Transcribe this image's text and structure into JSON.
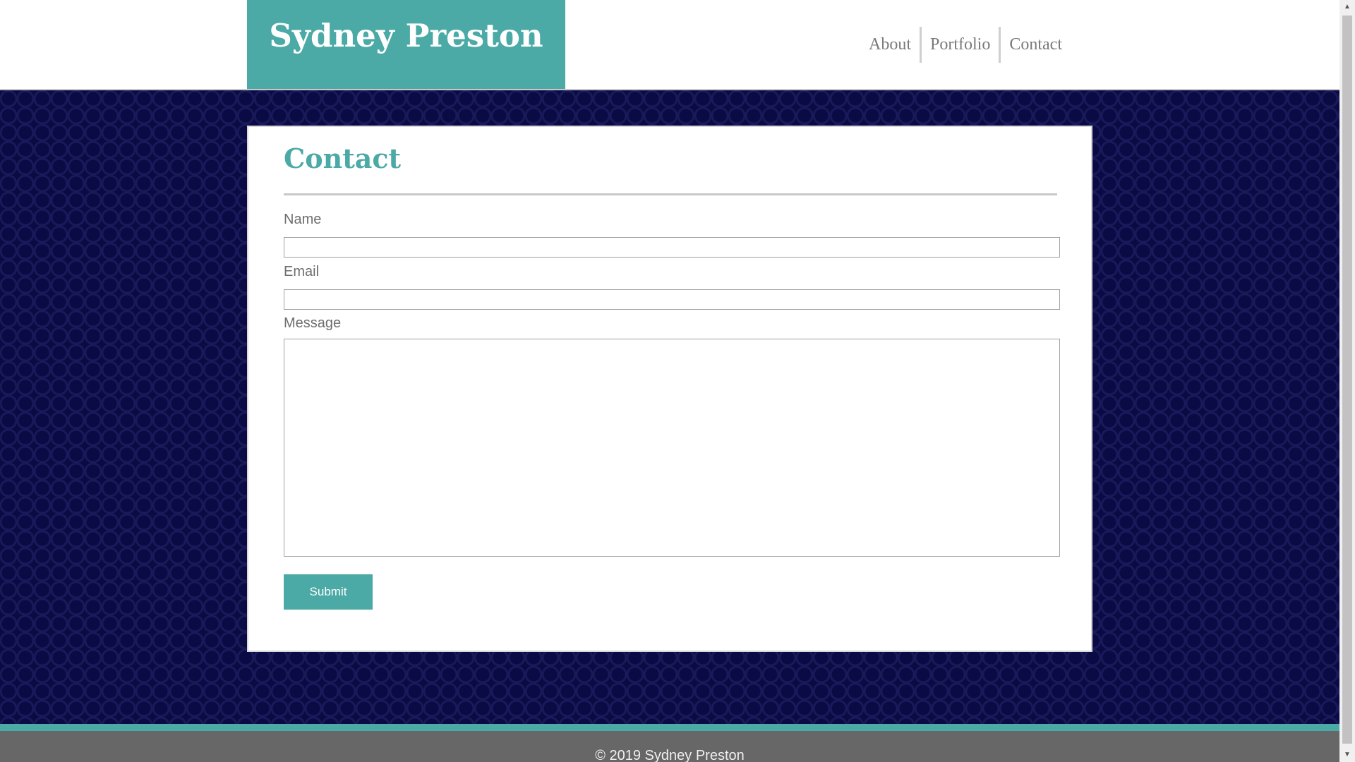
{
  "header": {
    "site_title": "Sydney Preston",
    "nav": [
      {
        "label": "About"
      },
      {
        "label": "Portfolio"
      },
      {
        "label": "Contact"
      }
    ]
  },
  "contact_form": {
    "title": "Contact",
    "name_label": "Name",
    "name_value": "",
    "email_label": "Email",
    "email_value": "",
    "message_label": "Message",
    "message_value": "",
    "submit_label": "Submit"
  },
  "footer": {
    "copyright": "© 2019 Sydney Preston"
  },
  "colors": {
    "accent": "#4ba9a6",
    "background_pattern": "#0a0a45",
    "footer": "#676767"
  },
  "icons": {
    "scroll_up": "scroll-up-arrow-icon",
    "scroll_down": "scroll-down-arrow-icon"
  }
}
